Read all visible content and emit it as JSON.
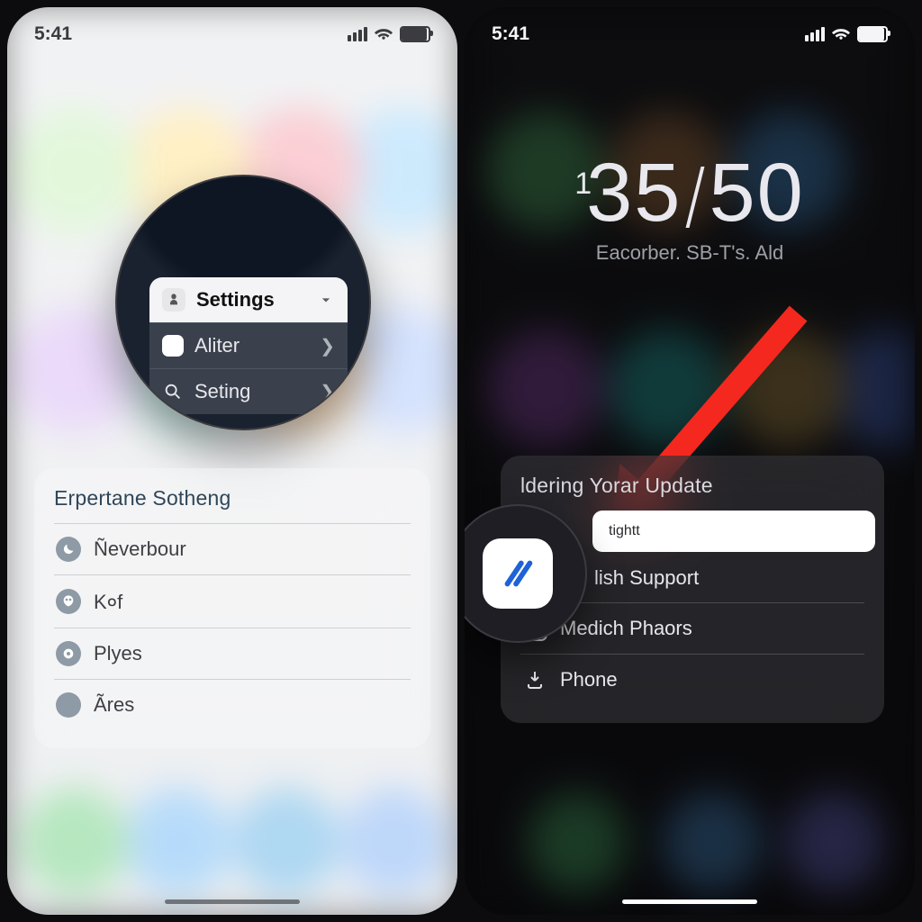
{
  "left": {
    "status_time": "5:41",
    "popover": {
      "header": "Settings",
      "items": [
        {
          "label": "Aliter"
        },
        {
          "label": "Seting"
        }
      ]
    },
    "widget": {
      "title": "Erpertane Sotheng",
      "items": [
        {
          "label": "Ñeverbour"
        },
        {
          "label": "K०f"
        },
        {
          "label": "Plyes"
        },
        {
          "label": "Ãres"
        }
      ]
    }
  },
  "right": {
    "status_time": "5:41",
    "clock": {
      "prefix": "1",
      "time": "35⁄50",
      "subtitle": "Eacorber. SB-T's. Ald"
    },
    "widget": {
      "title": "ldering Yorar Update",
      "highlight": "tightt",
      "items": [
        {
          "label": "lish Support"
        },
        {
          "label": "Medich Phaors"
        },
        {
          "label": "Phone"
        }
      ]
    }
  }
}
